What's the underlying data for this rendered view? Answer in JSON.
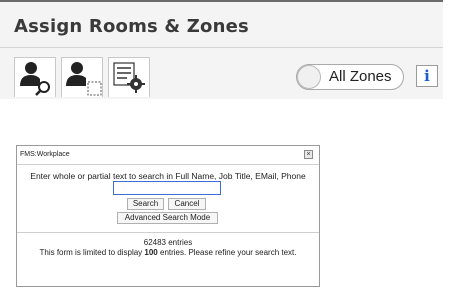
{
  "header": {
    "title": "Assign Rooms & Zones"
  },
  "toolbar": {
    "buttons": [
      {
        "icon": "person-search-icon"
      },
      {
        "icon": "person-select-area-icon"
      },
      {
        "icon": "list-settings-icon"
      }
    ],
    "zone_toggle_label": "All Zones",
    "info_label": "i"
  },
  "dialog": {
    "title": "FMS:Workplace",
    "close_label": "×",
    "prompt": "Enter whole or partial text to search in Full Name, Job Title, EMail, Phone",
    "search_value": "",
    "search_button": "Search",
    "cancel_button": "Cancel",
    "advanced_button": "Advanced Search Mode",
    "entries_count": "62483 entries",
    "limit_prefix": "This form is limited to display ",
    "limit_number": "100",
    "limit_suffix": " entries. Please refine your search text."
  },
  "colors": {
    "panel_bg": "#f4f4f4",
    "accent": "#3b6ed9",
    "info_blue": "#1a5fd0"
  }
}
